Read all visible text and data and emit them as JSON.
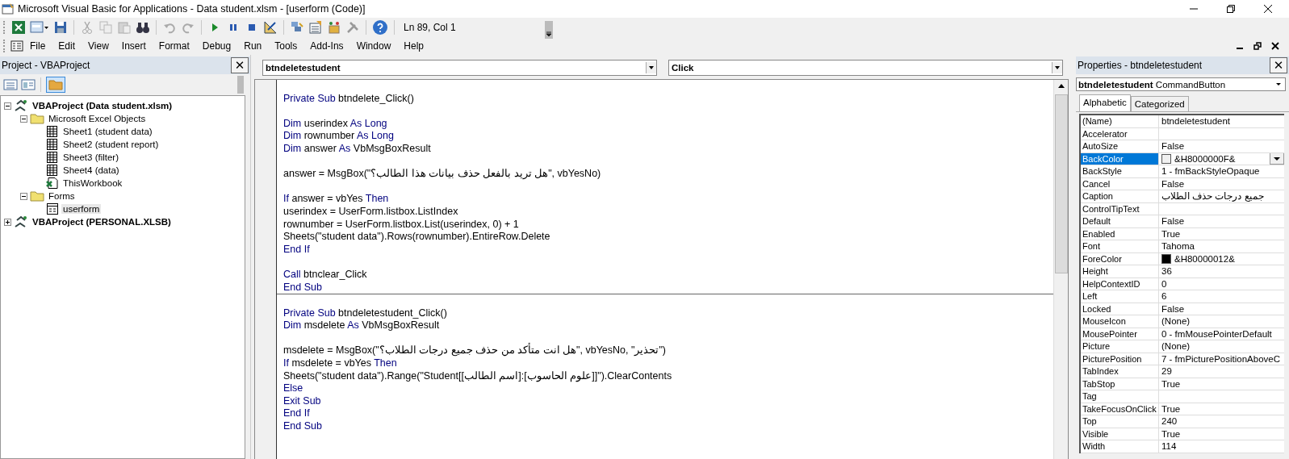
{
  "window": {
    "title": "Microsoft Visual Basic for Applications - Data student.xlsm - [userform (Code)]"
  },
  "toolbar": {
    "position": "Ln 89, Col 1"
  },
  "menu": [
    "File",
    "Edit",
    "View",
    "Insert",
    "Format",
    "Debug",
    "Run",
    "Tools",
    "Add-Ins",
    "Window",
    "Help"
  ],
  "project": {
    "title": "Project - VBAProject",
    "close": "✕",
    "tree": [
      {
        "label": "VBAProject (Data student.xlsm)",
        "kind": "project",
        "expanded": true,
        "selected": false,
        "children": [
          {
            "label": "Microsoft Excel Objects",
            "kind": "folder",
            "expanded": true,
            "selected": false,
            "children": [
              {
                "label": "Sheet1 (student data)",
                "kind": "sheet",
                "selected": false
              },
              {
                "label": "Sheet2 (student report)",
                "kind": "sheet",
                "selected": false
              },
              {
                "label": "Sheet3 (filter)",
                "kind": "sheet",
                "selected": false
              },
              {
                "label": "Sheet4 (data)",
                "kind": "sheet",
                "selected": false
              },
              {
                "label": "ThisWorkbook",
                "kind": "workbook",
                "selected": false
              }
            ]
          },
          {
            "label": "Forms",
            "kind": "folder",
            "expanded": true,
            "selected": false,
            "children": [
              {
                "label": "userform",
                "kind": "form",
                "selected": true
              }
            ]
          }
        ]
      },
      {
        "label": "VBAProject (PERSONAL.XLSB)",
        "kind": "project",
        "expanded": false,
        "selected": false
      }
    ]
  },
  "code": {
    "object": "btndeletestudent",
    "procedure": "Click",
    "procedures": [
      [
        {
          "kind": "blank"
        },
        {
          "kind": "code",
          "tokens": [
            {
              "text": "Private Sub",
              "kind": "keyword"
            },
            {
              "text": " btndelete_Click()",
              "kind": "plain"
            }
          ]
        },
        {
          "kind": "blank"
        },
        {
          "kind": "code",
          "tokens": [
            {
              "text": "Dim",
              "kind": "keyword"
            },
            {
              "text": " userindex ",
              "kind": "plain"
            },
            {
              "text": "As Long",
              "kind": "keyword"
            }
          ]
        },
        {
          "kind": "code",
          "tokens": [
            {
              "text": "Dim",
              "kind": "keyword"
            },
            {
              "text": " rownumber ",
              "kind": "plain"
            },
            {
              "text": "As Long",
              "kind": "keyword"
            }
          ]
        },
        {
          "kind": "code",
          "tokens": [
            {
              "text": "Dim",
              "kind": "keyword"
            },
            {
              "text": " answer ",
              "kind": "plain"
            },
            {
              "text": "As",
              "kind": "keyword"
            },
            {
              "text": " VbMsgBoxResult",
              "kind": "plain"
            }
          ]
        },
        {
          "kind": "blank"
        },
        {
          "kind": "code",
          "tokens": [
            {
              "text": "answer = MsgBox(\"هل تريد بالفعل حذف بيانات هذا الطالب؟\", vbYesNo)",
              "kind": "plain"
            }
          ]
        },
        {
          "kind": "blank"
        },
        {
          "kind": "code",
          "tokens": [
            {
              "text": "If",
              "kind": "keyword"
            },
            {
              "text": " answer = vbYes ",
              "kind": "plain"
            },
            {
              "text": "Then",
              "kind": "keyword"
            }
          ]
        },
        {
          "kind": "code",
          "tokens": [
            {
              "text": "userindex = UserForm.listbox.ListIndex",
              "kind": "plain"
            }
          ]
        },
        {
          "kind": "code",
          "tokens": [
            {
              "text": "rownumber = UserForm.listbox.List(userindex, 0) + 1",
              "kind": "plain"
            }
          ]
        },
        {
          "kind": "code",
          "tokens": [
            {
              "text": "Sheets(\"student data\").Rows(rownumber).EntireRow.Delete",
              "kind": "plain"
            }
          ]
        },
        {
          "kind": "code",
          "tokens": [
            {
              "text": "End If",
              "kind": "keyword"
            }
          ]
        },
        {
          "kind": "blank"
        },
        {
          "kind": "code",
          "tokens": [
            {
              "text": "Call",
              "kind": "keyword"
            },
            {
              "text": " btnclear_Click",
              "kind": "plain"
            }
          ]
        },
        {
          "kind": "code",
          "tokens": [
            {
              "text": "End Sub",
              "kind": "keyword"
            }
          ]
        }
      ],
      [
        {
          "kind": "blank"
        },
        {
          "kind": "code",
          "tokens": [
            {
              "text": "Private Sub",
              "kind": "keyword"
            },
            {
              "text": " btndeletestudent_Click()",
              "kind": "plain"
            }
          ]
        },
        {
          "kind": "code",
          "tokens": [
            {
              "text": "Dim",
              "kind": "keyword"
            },
            {
              "text": " msdelete ",
              "kind": "plain"
            },
            {
              "text": "As",
              "kind": "keyword"
            },
            {
              "text": " VbMsgBoxResult",
              "kind": "plain"
            }
          ]
        },
        {
          "kind": "blank"
        },
        {
          "kind": "code",
          "tokens": [
            {
              "text": "msdelete = MsgBox(\"هل انت متأكد من حذف جميع درجات الطلاب؟\", vbYesNo, \"تحذير\")",
              "kind": "plain"
            }
          ]
        },
        {
          "kind": "code",
          "tokens": [
            {
              "text": "If",
              "kind": "keyword"
            },
            {
              "text": " msdelete = vbYes ",
              "kind": "plain"
            },
            {
              "text": "Then",
              "kind": "keyword"
            }
          ]
        },
        {
          "kind": "code",
          "tokens": [
            {
              "text": "Sheets(\"student data\").Range(\"Student[[اسم الطالب]:[علوم الحاسوب]]\").ClearContents",
              "kind": "plain"
            }
          ]
        },
        {
          "kind": "code",
          "tokens": [
            {
              "text": "Else",
              "kind": "keyword"
            }
          ]
        },
        {
          "kind": "code",
          "tokens": [
            {
              "text": "Exit Sub",
              "kind": "keyword"
            }
          ]
        },
        {
          "kind": "code",
          "tokens": [
            {
              "text": "End If",
              "kind": "keyword"
            }
          ]
        },
        {
          "kind": "code",
          "tokens": [
            {
              "text": "End Sub",
              "kind": "keyword"
            }
          ]
        }
      ]
    ]
  },
  "properties": {
    "title": "Properties - btndeletestudent",
    "close": "✕",
    "object_name": "btndeletestudent",
    "object_type": "CommandButton",
    "tabs": [
      {
        "label": "Alphabetic",
        "selected": true
      },
      {
        "label": "Categorized",
        "selected": false
      }
    ],
    "rows": [
      {
        "name": "(Name)",
        "value": "btndeletestudent",
        "selected": false
      },
      {
        "name": "Accelerator",
        "selected": false
      },
      {
        "name": "AutoSize",
        "value": "False",
        "selected": false
      },
      {
        "name": "BackColor",
        "value": "&H8000000F&",
        "color": "#f0f0f0",
        "selected": true
      },
      {
        "name": "BackStyle",
        "value": "1 - fmBackStyleOpaque",
        "selected": false
      },
      {
        "name": "Cancel",
        "value": "False",
        "selected": false
      },
      {
        "name": "Caption",
        "value": "جميع درجات حذف الطلاب",
        "selected": false
      },
      {
        "name": "ControlTipText",
        "selected": false
      },
      {
        "name": "Default",
        "value": "False",
        "selected": false
      },
      {
        "name": "Enabled",
        "value": "True",
        "selected": false
      },
      {
        "name": "Font",
        "value": "Tahoma",
        "selected": false
      },
      {
        "name": "ForeColor",
        "value": "&H80000012&",
        "color": "#000000",
        "selected": false
      },
      {
        "name": "Height",
        "value": "36",
        "selected": false
      },
      {
        "name": "HelpContextID",
        "value": "0",
        "selected": false
      },
      {
        "name": "Left",
        "value": "6",
        "selected": false
      },
      {
        "name": "Locked",
        "value": "False",
        "selected": false
      },
      {
        "name": "MouseIcon",
        "value": "(None)",
        "selected": false
      },
      {
        "name": "MousePointer",
        "value": "0 - fmMousePointerDefault",
        "selected": false
      },
      {
        "name": "Picture",
        "value": "(None)",
        "selected": false
      },
      {
        "name": "PicturePosition",
        "value": "7 - fmPicturePositionAboveC",
        "selected": false
      },
      {
        "name": "TabIndex",
        "value": "29",
        "selected": false
      },
      {
        "name": "TabStop",
        "value": "True",
        "selected": false
      },
      {
        "name": "Tag",
        "selected": false
      },
      {
        "name": "TakeFocusOnClick",
        "value": "True",
        "selected": false
      },
      {
        "name": "Top",
        "value": "240",
        "selected": false
      },
      {
        "name": "Visible",
        "value": "True",
        "selected": false
      },
      {
        "name": "Width",
        "value": "114",
        "selected": false
      }
    ]
  }
}
